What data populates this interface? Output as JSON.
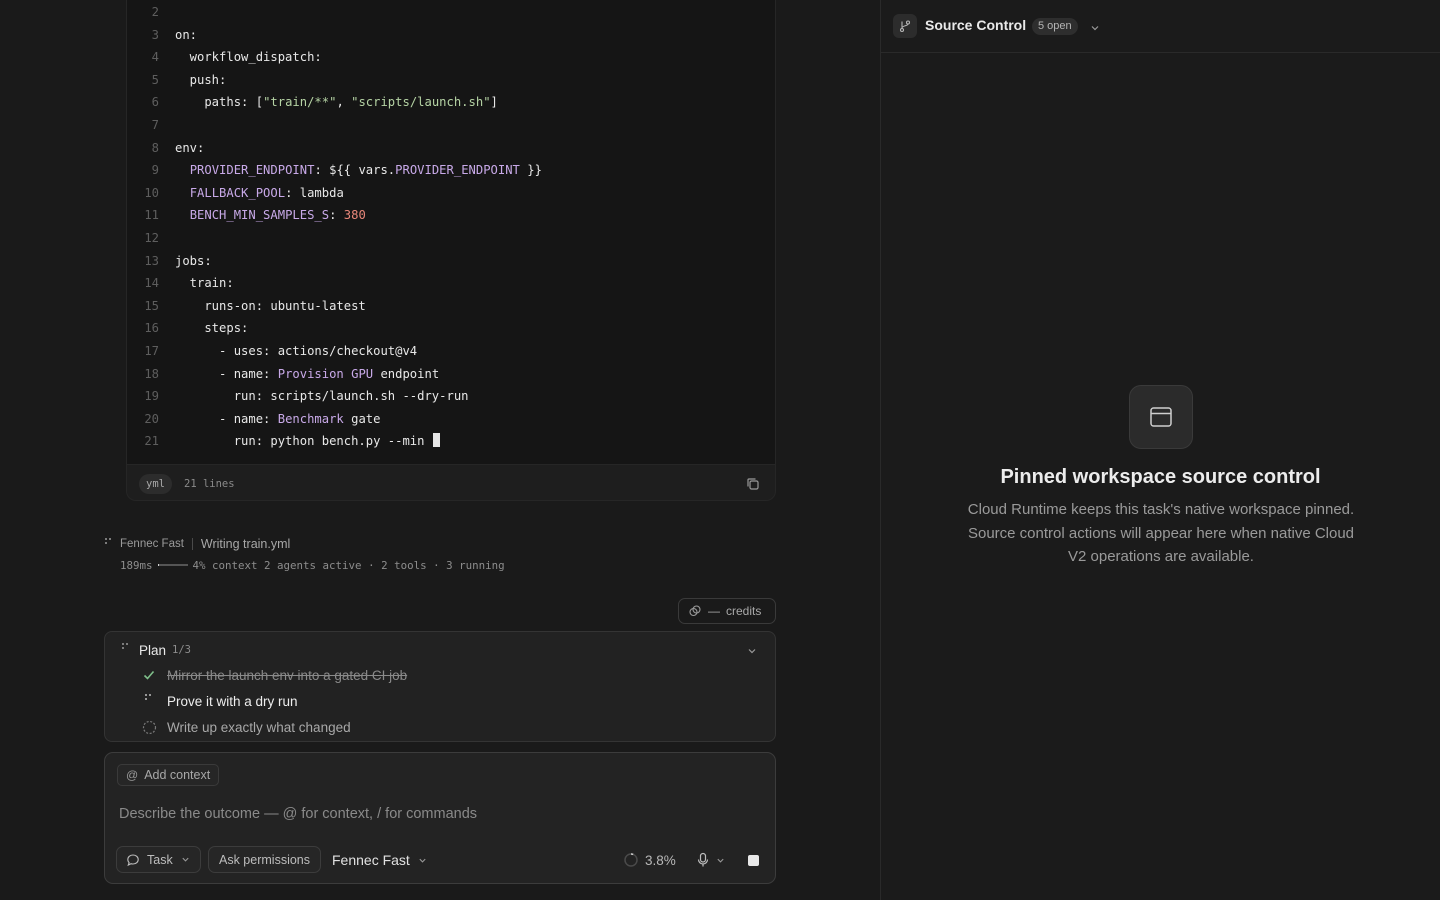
{
  "code": {
    "language": "yml",
    "line_count_label": "21 lines",
    "lines": [
      {
        "n": "2",
        "segs": []
      },
      {
        "n": "3",
        "segs": [
          [
            "on:",
            ""
          ]
        ]
      },
      {
        "n": "4",
        "segs": [
          [
            "  workflow_dispatch:",
            ""
          ]
        ]
      },
      {
        "n": "5",
        "segs": [
          [
            "  push:",
            ""
          ]
        ]
      },
      {
        "n": "6",
        "segs": [
          [
            "    paths: [",
            ""
          ],
          [
            "\"train/**\"",
            "str"
          ],
          [
            ", ",
            ""
          ],
          [
            "\"scripts/launch.sh\"",
            "str"
          ],
          [
            "]",
            ""
          ]
        ]
      },
      {
        "n": "7",
        "segs": []
      },
      {
        "n": "8",
        "segs": [
          [
            "env:",
            ""
          ]
        ]
      },
      {
        "n": "9",
        "segs": [
          [
            "  ",
            ""
          ],
          [
            "PROVIDER_ENDPOINT",
            "key"
          ],
          [
            ": ${{ vars.",
            ""
          ],
          [
            "PROVIDER_ENDPOINT",
            "key"
          ],
          [
            " }}",
            ""
          ]
        ]
      },
      {
        "n": "10",
        "segs": [
          [
            "  ",
            ""
          ],
          [
            "FALLBACK_POOL",
            "key"
          ],
          [
            ": lambda",
            ""
          ]
        ]
      },
      {
        "n": "11",
        "segs": [
          [
            "  ",
            ""
          ],
          [
            "BENCH_MIN_SAMPLES_S",
            "key"
          ],
          [
            ": ",
            ""
          ],
          [
            "380",
            "num"
          ]
        ]
      },
      {
        "n": "12",
        "segs": []
      },
      {
        "n": "13",
        "segs": [
          [
            "jobs:",
            ""
          ]
        ]
      },
      {
        "n": "14",
        "segs": [
          [
            "  train:",
            ""
          ]
        ]
      },
      {
        "n": "15",
        "segs": [
          [
            "    runs-on: ubuntu-latest",
            ""
          ]
        ]
      },
      {
        "n": "16",
        "segs": [
          [
            "    steps:",
            ""
          ]
        ]
      },
      {
        "n": "17",
        "segs": [
          [
            "      - uses: actions/checkout@v4",
            ""
          ]
        ]
      },
      {
        "n": "18",
        "segs": [
          [
            "      - name: ",
            ""
          ],
          [
            "Provision GPU",
            "key"
          ],
          [
            " endpoint",
            ""
          ]
        ]
      },
      {
        "n": "19",
        "segs": [
          [
            "        run: scripts/launch.sh --dry-run",
            ""
          ]
        ]
      },
      {
        "n": "20",
        "segs": [
          [
            "      - name: ",
            ""
          ],
          [
            "Benchmark",
            "key"
          ],
          [
            " gate",
            ""
          ]
        ]
      },
      {
        "n": "21",
        "segs": [
          [
            "        run: python bench.py --min ",
            ""
          ]
        ],
        "cursor": true
      }
    ]
  },
  "status": {
    "agent_name": "Fennec Fast",
    "action": "Writing train.yml",
    "latency": "189ms",
    "context_fill": 0.04,
    "context_label": "4% context",
    "agents": "2 agents active",
    "tools": "2 tools",
    "running": "3 running",
    "dot": "·"
  },
  "credits": {
    "value": "—",
    "label": "credits"
  },
  "plan": {
    "title": "Plan",
    "count": "1/3",
    "items": [
      {
        "text": "Mirror the launch env into a gated CI job",
        "state": "done"
      },
      {
        "text": "Prove it with a dry run",
        "state": "active"
      },
      {
        "text": "Write up exactly what changed",
        "state": "todo"
      }
    ]
  },
  "composer": {
    "add_context_label": "Add context",
    "add_context_symbol": "@",
    "placeholder": "Describe the outcome — @ for context, / for commands",
    "value": "",
    "mode_label": "Task",
    "permissions_label": "Ask permissions",
    "model_label": "Fennec Fast",
    "usage_percent": "3.8%",
    "usage_fraction": 0.038
  },
  "source_control": {
    "title": "Source Control",
    "badge": "5 open",
    "empty_title": "Pinned workspace source control",
    "empty_description": "Cloud Runtime keeps this task's native workspace pinned. Source control actions will appear here when native Cloud V2 operations are available."
  },
  "colors": {
    "background": "#1a1a1a",
    "code_background": "#151515",
    "keyword": "#c8a9e8",
    "string": "#b5d3a4",
    "number": "#e8877a",
    "check": "#7fbf8a"
  },
  "icons": {
    "copy": "copy-icon",
    "branch": "git-branch-icon",
    "panel": "panel-icon",
    "chevron": "chevron-down-icon",
    "mic": "microphone-icon",
    "chat": "chat-bubble-icon",
    "credits": "credits-icon",
    "check": "check-icon",
    "spinner": "spinner-icon",
    "pending": "pending-circle-icon",
    "stop": "stop-icon"
  }
}
